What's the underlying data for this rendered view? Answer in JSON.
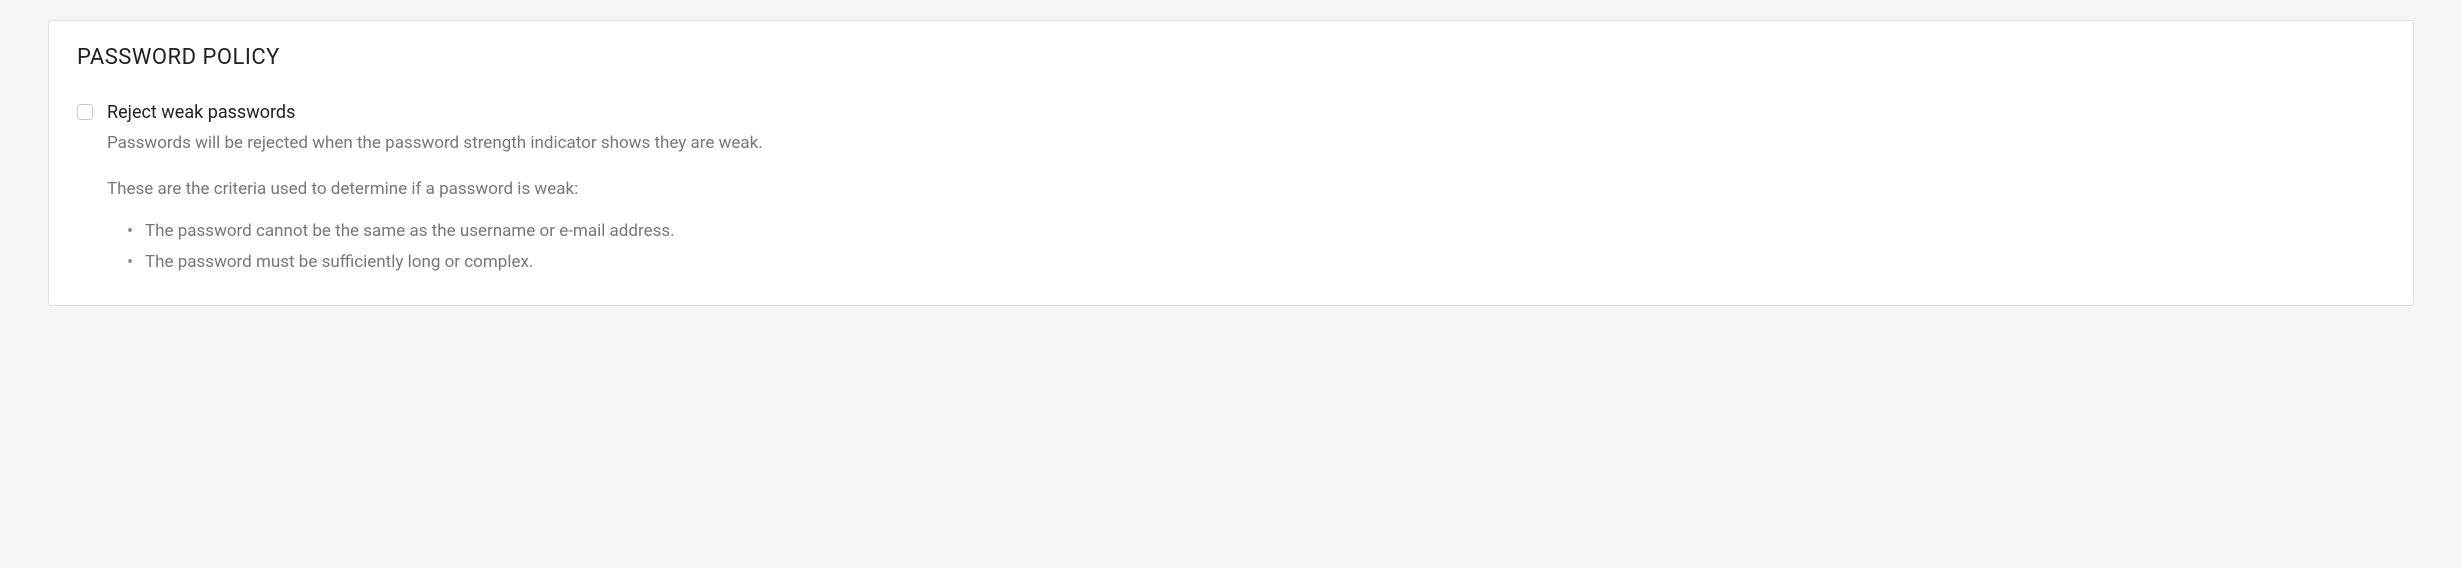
{
  "panel": {
    "title": "PASSWORD POLICY",
    "option": {
      "label": "Reject weak passwords",
      "description": "Passwords will be rejected when the password strength indicator shows they are weak.",
      "criteria_intro": "These are the criteria used to determine if a password is weak:",
      "criteria": [
        "The password cannot be the same as the username or e-mail address.",
        "The password must be sufficiently long or complex."
      ]
    }
  }
}
